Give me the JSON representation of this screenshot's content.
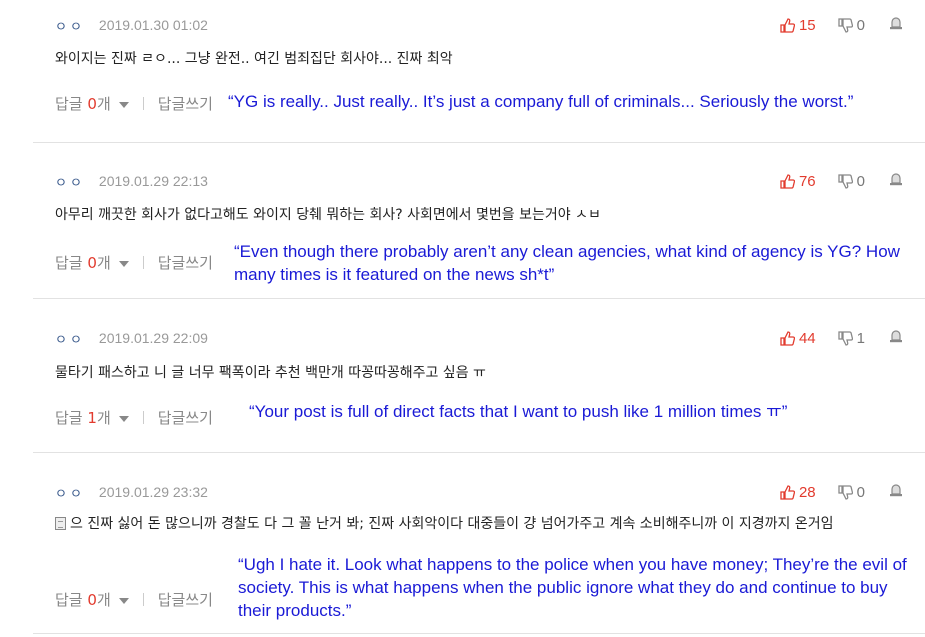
{
  "comments": [
    {
      "user": "ㅇㅇ",
      "date": "2019.01.30 01:02",
      "up": "15",
      "down": "0",
      "text": "와이지는 진짜 ㄹㅇ... 그냥 완전.. 여긴 범죄집단 회사야... 진짜 최악",
      "reply_label": "답글",
      "reply_count": "0",
      "reply_unit": "개",
      "write_label": "답글쓰기",
      "translation": "“YG is really.. Just really.. It’s just a company full of criminals... Seriously the worst.”"
    },
    {
      "user": "ㅇㅇ",
      "date": "2019.01.29 22:13",
      "up": "76",
      "down": "0",
      "text": "아무리 깨끗한 회사가 없다고해도 와이지 당췌 뭐하는 회사? 사회면에서 몇번을 보는거야 ㅅㅂ",
      "reply_label": "답글",
      "reply_count": "0",
      "reply_unit": "개",
      "write_label": "답글쓰기",
      "translation": "“Even though there probably aren’t any clean agencies, what kind of agency is YG? How many times is it featured on the news sh*t”"
    },
    {
      "user": "ㅇㅇ",
      "date": "2019.01.29 22:09",
      "up": "44",
      "down": "1",
      "text": "물타기 패스하고 니 글 너무 팩폭이라 추천 백만개 따꽁따꽁해주고 싶음 ㅠ",
      "reply_label": "답글",
      "reply_count": "1",
      "reply_unit": "개",
      "write_label": "답글쓰기",
      "translation": "“Your post is full of direct facts that I want to push like 1 million times ㅠ”"
    },
    {
      "user": "ㅇㅇ",
      "date": "2019.01.29 23:32",
      "up": "28",
      "down": "0",
      "text": "으 진짜 싫어 돈 많으니까 경찰도 다 그 꼴 난거 봐; 진짜 사회악이다 대중들이 걍 넘어가주고 계속 소비해주니까 이 지경까지 온거임",
      "reply_label": "답글",
      "reply_count": "0",
      "reply_unit": "개",
      "write_label": "답글쓰기",
      "translation": "“Ugh I hate it. Look what happens to the police when you have money; They’re the evil of society. This is what happens when the public ignore what they do and continue to buy their products.”"
    }
  ]
}
